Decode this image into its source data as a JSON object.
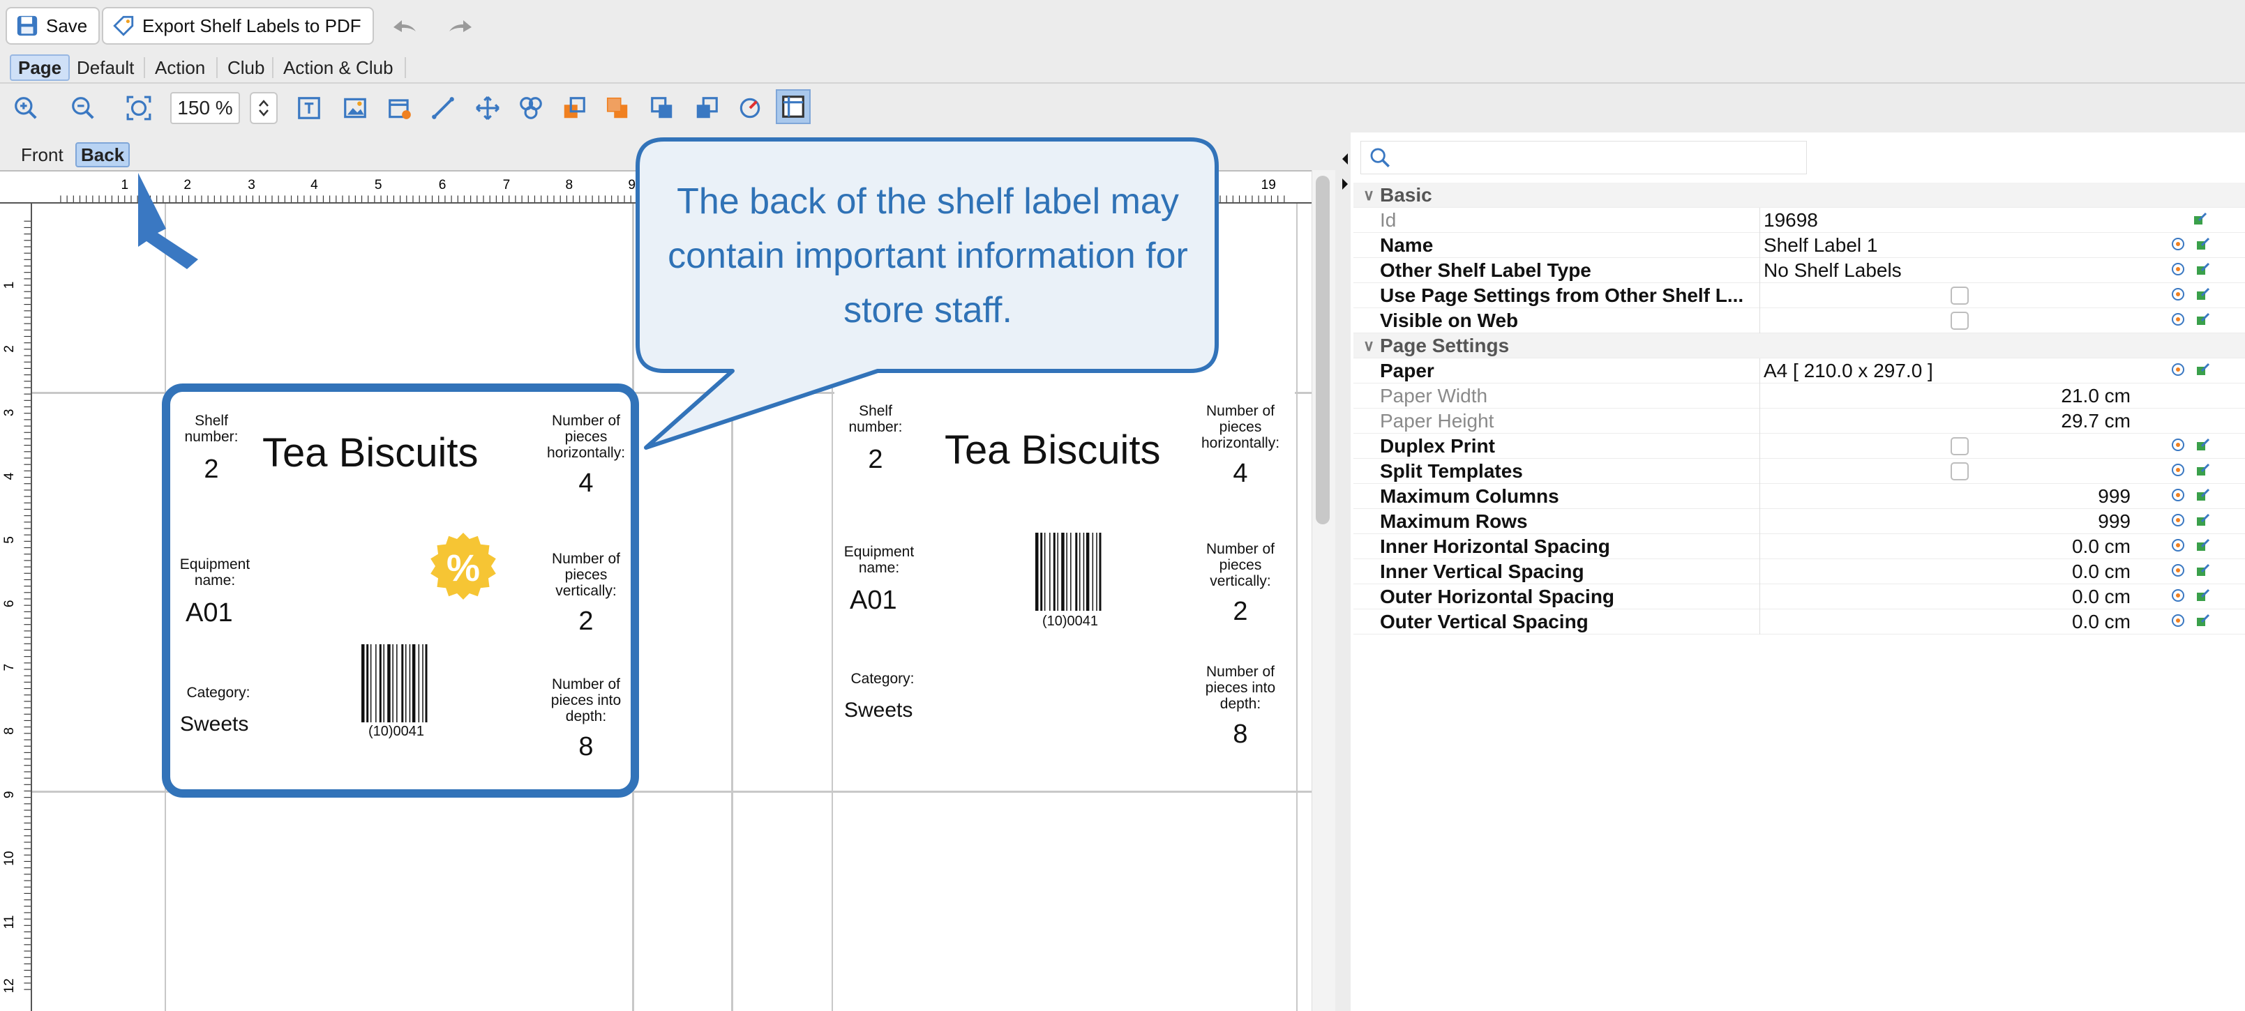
{
  "toolbar": {
    "save_label": "Save",
    "export_label": "Export Shelf Labels to PDF"
  },
  "modes": [
    "Page",
    "Default",
    "Action",
    "Club",
    "Action & Club"
  ],
  "zoom": "150 %",
  "sides": {
    "front": "Front",
    "back": "Back"
  },
  "ruler": {
    "h_ticks": [
      "1",
      "2",
      "3",
      "4",
      "5",
      "6",
      "7",
      "8",
      "9",
      "18",
      "19"
    ],
    "v_ticks": [
      "1",
      "2",
      "3",
      "4",
      "5",
      "6",
      "7",
      "8",
      "9",
      "10",
      "11",
      "12"
    ]
  },
  "label_back": {
    "shelf_number_label": "Shelf number:",
    "shelf_number": "2",
    "title": "Tea Biscuits",
    "h_pieces_label": "Number of pieces horizontally:",
    "h_pieces": "4",
    "equipment_label": "Equipment name:",
    "equipment": "A01",
    "v_pieces_label": "Number of pieces vertically:",
    "v_pieces": "2",
    "category_label": "Category:",
    "category": "Sweets",
    "barcode_caption": "(10)0041",
    "depth_label": "Number of pieces into depth:",
    "depth": "8",
    "discount_symbol": "%"
  },
  "label_front": {
    "shelf_number_label": "Shelf number:",
    "shelf_number": "2",
    "title": "Tea Biscuits",
    "h_pieces_label": "Number of pieces horizontally:",
    "h_pieces": "4",
    "equipment_label": "Equipment name:",
    "equipment": "A01",
    "v_pieces_label": "Number of pieces vertically:",
    "v_pieces": "2",
    "category_label": "Category:",
    "category": "Sweets",
    "barcode_caption": "(10)0041",
    "depth_label": "Number of pieces into depth:",
    "depth": "8"
  },
  "callout": {
    "text": "The back of the shelf label may contain important information for store staff."
  },
  "search": {
    "placeholder": ""
  },
  "properties": {
    "basic_header": "Basic",
    "page_header": "Page Settings",
    "rows": {
      "id": {
        "name": "Id",
        "value": "19698"
      },
      "name": {
        "name": "Name",
        "value": "Shelf Label 1"
      },
      "other_type": {
        "name": "Other Shelf Label Type",
        "value": "No Shelf Labels"
      },
      "use_page": {
        "name": "Use Page Settings from Other Shelf L..."
      },
      "visible_web": {
        "name": "Visible on Web"
      },
      "paper": {
        "name": "Paper",
        "value": "A4 [ 210.0 x 297.0 ]"
      },
      "paper_width": {
        "name": "Paper Width",
        "value": "21.0 cm"
      },
      "paper_height": {
        "name": "Paper Height",
        "value": "29.7 cm"
      },
      "duplex": {
        "name": "Duplex Print"
      },
      "split": {
        "name": "Split Templates"
      },
      "max_cols": {
        "name": "Maximum Columns",
        "value": "999"
      },
      "max_rows": {
        "name": "Maximum Rows",
        "value": "999"
      },
      "inner_h": {
        "name": "Inner Horizontal Spacing",
        "value": "0.0 cm"
      },
      "inner_v": {
        "name": "Inner Vertical Spacing",
        "value": "0.0 cm"
      },
      "outer_h": {
        "name": "Outer Horizontal Spacing",
        "value": "0.0 cm"
      },
      "outer_v": {
        "name": "Outer Vertical Spacing",
        "value": "0.0 cm"
      }
    }
  },
  "colors": {
    "accent": "#3273b9",
    "callout_fill": "#eaf1f8",
    "badge_yellow": "#f6c534",
    "tab_active": "#b8d3f3"
  }
}
